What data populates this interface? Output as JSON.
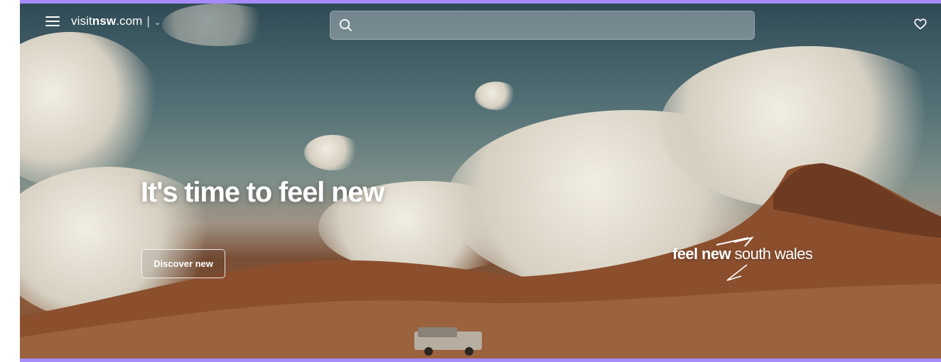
{
  "header": {
    "logo_prefix": "visit",
    "logo_bold": "nsw",
    "logo_suffix": ".com",
    "divider": "|",
    "chevron": "⌄",
    "search_placeholder": ""
  },
  "hero": {
    "headline": "It's time to feel new",
    "cta_label": "Discover new"
  },
  "brand": {
    "bold": "feel new",
    "regular": "south wales"
  },
  "icons": {
    "menu": "hamburger-menu-icon",
    "search": "search-icon",
    "favourites": "heart-icon"
  },
  "colors": {
    "frame": "#a78bfa",
    "text": "#ffffff"
  }
}
